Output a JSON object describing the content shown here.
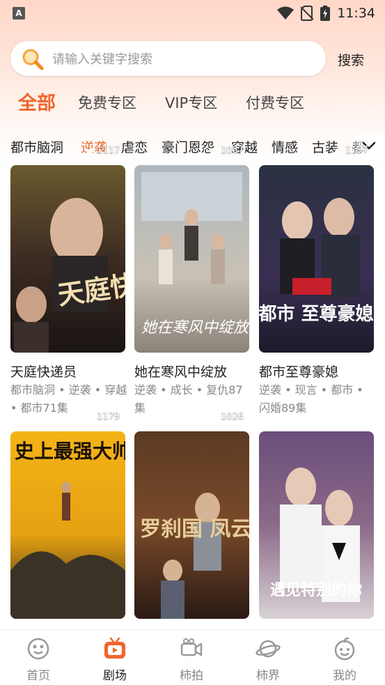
{
  "status_bar": {
    "time": "11:34",
    "app_icon": "A"
  },
  "search": {
    "placeholder": "请输入关键字搜索",
    "value": "",
    "button_label": "搜索"
  },
  "main_tabs": [
    {
      "label": "全部",
      "active": true
    },
    {
      "label": "免费专区",
      "active": false
    },
    {
      "label": "VIP专区",
      "active": false
    },
    {
      "label": "付费专区",
      "active": false
    }
  ],
  "categories": [
    {
      "label": "都市脑洞",
      "active": false
    },
    {
      "label": "逆袭",
      "active": true
    },
    {
      "label": "虐恋",
      "active": false
    },
    {
      "label": "豪门恩怨",
      "active": false
    },
    {
      "label": "穿越",
      "active": false
    },
    {
      "label": "情感",
      "active": false
    },
    {
      "label": "古装",
      "active": false
    },
    {
      "label": "都",
      "active": false
    }
  ],
  "dramas": [
    {
      "title": "天庭快递员",
      "tags": "都市脑洞 • 逆袭 • 穿越 • 都市71集",
      "views": "1117",
      "poster_title": "天庭快递员"
    },
    {
      "title": "她在寒风中绽放",
      "tags": "逆袭 • 成长 • 复仇87集",
      "views": "1087",
      "poster_title": "她在寒风中绽放"
    },
    {
      "title": "都市至尊豪媳",
      "tags": "逆袭 • 现言 • 都市 • 闪婚89集",
      "views": "1197",
      "poster_title": "都市 至尊豪媳"
    },
    {
      "title": "史上最强大帅",
      "tags": "",
      "views": "1179",
      "poster_title": "史上最强大帅"
    },
    {
      "title": "罗刹国凤云",
      "tags": "",
      "views": "1026",
      "poster_title": "罗刹国 凤云"
    },
    {
      "title": "遇见特别的你",
      "tags": "",
      "views": "",
      "poster_title": "遇见特别的你"
    }
  ],
  "bottom_nav": [
    {
      "label": "首页",
      "icon": "home-icon",
      "active": false
    },
    {
      "label": "剧场",
      "icon": "tv-icon",
      "active": true
    },
    {
      "label": "柿拍",
      "icon": "camera-icon",
      "active": false
    },
    {
      "label": "柿界",
      "icon": "planet-icon",
      "active": false
    },
    {
      "label": "我的",
      "icon": "profile-icon",
      "active": false
    }
  ],
  "colors": {
    "accent": "#f0662c",
    "header_gradient_top": "#ffd7c7",
    "text": "#222222",
    "muted": "#888888"
  }
}
